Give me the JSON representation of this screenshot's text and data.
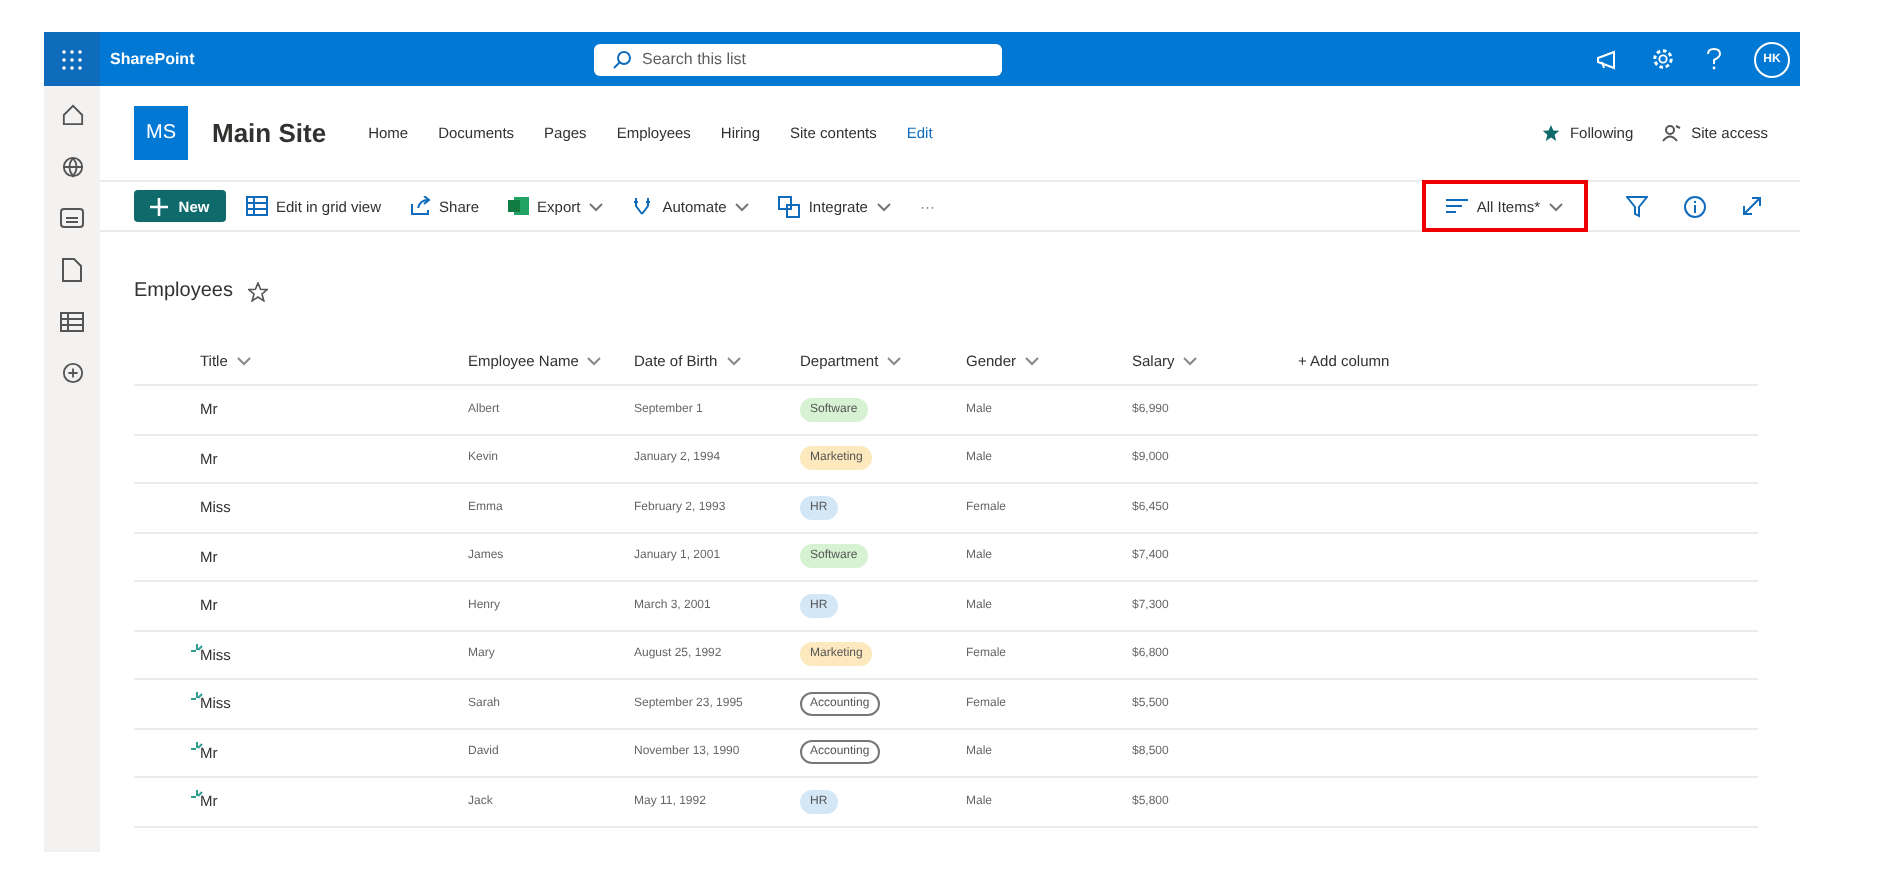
{
  "app_bar": {
    "app_name": "SharePoint",
    "search": {
      "placeholder": "Search this list"
    },
    "avatar": "HK"
  },
  "site": {
    "logo": "MS",
    "title": "Main Site",
    "nav": [
      "Home",
      "Documents",
      "Pages",
      "Employees",
      "Hiring",
      "Site contents"
    ],
    "edit_link": "Edit",
    "following": "Following",
    "site_access": "Site access"
  },
  "command_bar": {
    "new_button": "New",
    "commands": [
      {
        "label": "Edit in grid view",
        "kind": "grid",
        "dropdown": false
      },
      {
        "label": "Share",
        "kind": "share",
        "dropdown": false
      },
      {
        "label": "Export",
        "kind": "spreadsheet",
        "dropdown": true
      },
      {
        "label": "Automate",
        "kind": "flow",
        "dropdown": true
      },
      {
        "label": "Integrate",
        "kind": "integrate",
        "dropdown": true
      }
    ],
    "more": "···",
    "view": {
      "label": "All Items*",
      "highlighted": true
    }
  },
  "list": {
    "title": "Employees",
    "favorite": false,
    "columns": [
      "Title",
      "Employee Name",
      "Date of Birth",
      "Department",
      "Gender",
      "Salary"
    ],
    "add_column": "+ Add column",
    "rows": [
      {
        "title": "Mr",
        "name": "Albert",
        "dob": "September 1",
        "department": {
          "label": "Software",
          "kind": "filled",
          "color": "#d6f2d2"
        },
        "gender": "Male",
        "salary": "$6,990",
        "is_new": false
      },
      {
        "title": "Mr",
        "name": "Kevin",
        "dob": "January 2, 1994",
        "department": {
          "label": "Marketing",
          "kind": "filled",
          "color": "#fde9bd"
        },
        "gender": "Male",
        "salary": "$9,000",
        "is_new": false
      },
      {
        "title": "Miss",
        "name": "Emma",
        "dob": "February 2, 1993",
        "department": {
          "label": "HR",
          "kind": "filled",
          "color": "#d4e7f7"
        },
        "gender": "Female",
        "salary": "$6,450",
        "is_new": false
      },
      {
        "title": "Mr",
        "name": "James",
        "dob": "January 1, 2001",
        "department": {
          "label": "Software",
          "kind": "filled",
          "color": "#d6f2d2"
        },
        "gender": "Male",
        "salary": "$7,400",
        "is_new": false
      },
      {
        "title": "Mr",
        "name": "Henry",
        "dob": "March 3, 2001",
        "department": {
          "label": "HR",
          "kind": "filled",
          "color": "#d4e7f7"
        },
        "gender": "Male",
        "salary": "$7,300",
        "is_new": false
      },
      {
        "title": "Miss",
        "name": "Mary",
        "dob": "August 25, 1992",
        "department": {
          "label": "Marketing",
          "kind": "filled",
          "color": "#fde9bd"
        },
        "gender": "Female",
        "salary": "$6,800",
        "is_new": true
      },
      {
        "title": "Miss",
        "name": "Sarah",
        "dob": "September 23, 1995",
        "department": {
          "label": "Accounting",
          "kind": "outline",
          "color": "#ffffff"
        },
        "gender": "Female",
        "salary": "$5,500",
        "is_new": true
      },
      {
        "title": "Mr",
        "name": "David",
        "dob": "November 13, 1990",
        "department": {
          "label": "Accounting",
          "kind": "outline",
          "color": "#ffffff"
        },
        "gender": "Male",
        "salary": "$8,500",
        "is_new": true
      },
      {
        "title": "Mr",
        "name": "Jack",
        "dob": "May 11, 1992",
        "department": {
          "label": "HR",
          "kind": "filled",
          "color": "#d4e7f7"
        },
        "gender": "Male",
        "salary": "$5,800",
        "is_new": true
      }
    ]
  }
}
